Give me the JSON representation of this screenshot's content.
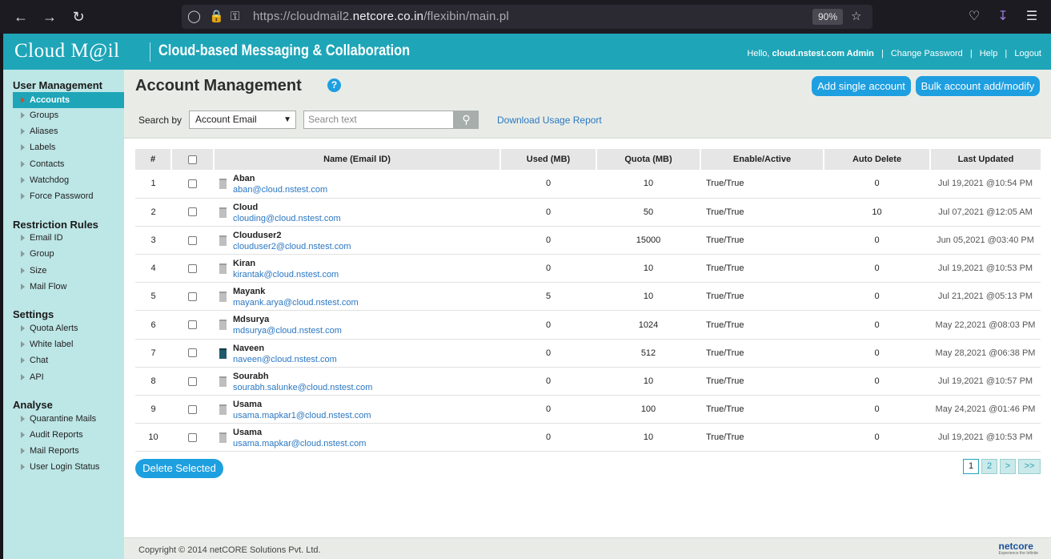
{
  "browser": {
    "url_prefix": "https://cloudmail2.",
    "url_domain": "netcore.co.in",
    "url_path": "/flexibin/main.pl",
    "zoom": "90%"
  },
  "header": {
    "logo": "Cloud M@il",
    "tagline": "Cloud-based Messaging & Collaboration",
    "hello": "Hello,",
    "user": "cloud.nstest.com Admin",
    "change_password": "Change Password",
    "help": "Help",
    "logout": "Logout"
  },
  "sidebar": {
    "sections": [
      {
        "title": "User Management",
        "items": [
          "Accounts",
          "Groups",
          "Aliases",
          "Labels",
          "Contacts",
          "Watchdog",
          "Force Password"
        ]
      },
      {
        "title": "Restriction Rules",
        "items": [
          "Email ID",
          "Group",
          "Size",
          "Mail Flow"
        ]
      },
      {
        "title": "Settings",
        "items": [
          "Quota Alerts",
          "White label",
          "Chat",
          "API"
        ]
      },
      {
        "title": "Analyse",
        "items": [
          "Quarantine Mails",
          "Audit Reports",
          "Mail Reports",
          "User Login Status"
        ]
      }
    ]
  },
  "main": {
    "title": "Account Management",
    "add_single": "Add single account",
    "bulk": "Bulk account add/modify",
    "search_by": "Search by",
    "search_field": "Account Email",
    "search_placeholder": "Search text",
    "download_report": "Download Usage Report",
    "delete_selected": "Delete Selected"
  },
  "table": {
    "headers": [
      "#",
      "",
      "Name (Email ID)",
      "Used (MB)",
      "Quota (MB)",
      "Enable/Active",
      "Auto Delete",
      "Last Updated"
    ],
    "rows": [
      {
        "num": "1",
        "name": "Aban",
        "email": "aban@cloud.nstest.com",
        "used": "0",
        "quota": "10",
        "enable": "True/True",
        "auto_delete": "0",
        "updated": "Jul 19,2021 @10:54 PM"
      },
      {
        "num": "2",
        "name": "Cloud",
        "email": "clouding@cloud.nstest.com",
        "used": "0",
        "quota": "50",
        "enable": "True/True",
        "auto_delete": "10",
        "updated": "Jul 07,2021 @12:05 AM"
      },
      {
        "num": "3",
        "name": "Clouduser2",
        "email": "clouduser2@cloud.nstest.com",
        "used": "0",
        "quota": "15000",
        "enable": "True/True",
        "auto_delete": "0",
        "updated": "Jun 05,2021 @03:40 PM"
      },
      {
        "num": "4",
        "name": "Kiran",
        "email": "kirantak@cloud.nstest.com",
        "used": "0",
        "quota": "10",
        "enable": "True/True",
        "auto_delete": "0",
        "updated": "Jul 19,2021 @10:53 PM"
      },
      {
        "num": "5",
        "name": "Mayank",
        "email": "mayank.arya@cloud.nstest.com",
        "used": "5",
        "quota": "10",
        "enable": "True/True",
        "auto_delete": "0",
        "updated": "Jul 21,2021 @05:13 PM"
      },
      {
        "num": "6",
        "name": "Mdsurya",
        "email": "mdsurya@cloud.nstest.com",
        "used": "0",
        "quota": "1024",
        "enable": "True/True",
        "auto_delete": "0",
        "updated": "May 22,2021 @08:03 PM"
      },
      {
        "num": "7",
        "name": "Naveen",
        "email": "naveen@cloud.nstest.com",
        "used": "0",
        "quota": "512",
        "enable": "True/True",
        "auto_delete": "0",
        "updated": "May 28,2021 @06:38 PM"
      },
      {
        "num": "8",
        "name": "Sourabh",
        "email": "sourabh.salunke@cloud.nstest.com",
        "used": "0",
        "quota": "10",
        "enable": "True/True",
        "auto_delete": "0",
        "updated": "Jul 19,2021 @10:57 PM"
      },
      {
        "num": "9",
        "name": "Usama",
        "email": "usama.mapkar1@cloud.nstest.com",
        "used": "0",
        "quota": "100",
        "enable": "True/True",
        "auto_delete": "0",
        "updated": "May 24,2021 @01:46 PM"
      },
      {
        "num": "10",
        "name": "Usama",
        "email": "usama.mapkar@cloud.nstest.com",
        "used": "0",
        "quota": "10",
        "enable": "True/True",
        "auto_delete": "0",
        "updated": "Jul 19,2021 @10:53 PM"
      }
    ]
  },
  "pagination": [
    "1",
    "2",
    ">",
    ">>"
  ],
  "footer": {
    "copyright": "Copyright © 2014 netCORE Solutions Pvt. Ltd.",
    "brand": "netcore",
    "brand_tagline": "Experience the Infinite"
  },
  "colors": {
    "teal": "#1ea5b8",
    "sidebar": "#bde6e6",
    "button_blue": "#1e9fe0",
    "link": "#2a77c2"
  }
}
